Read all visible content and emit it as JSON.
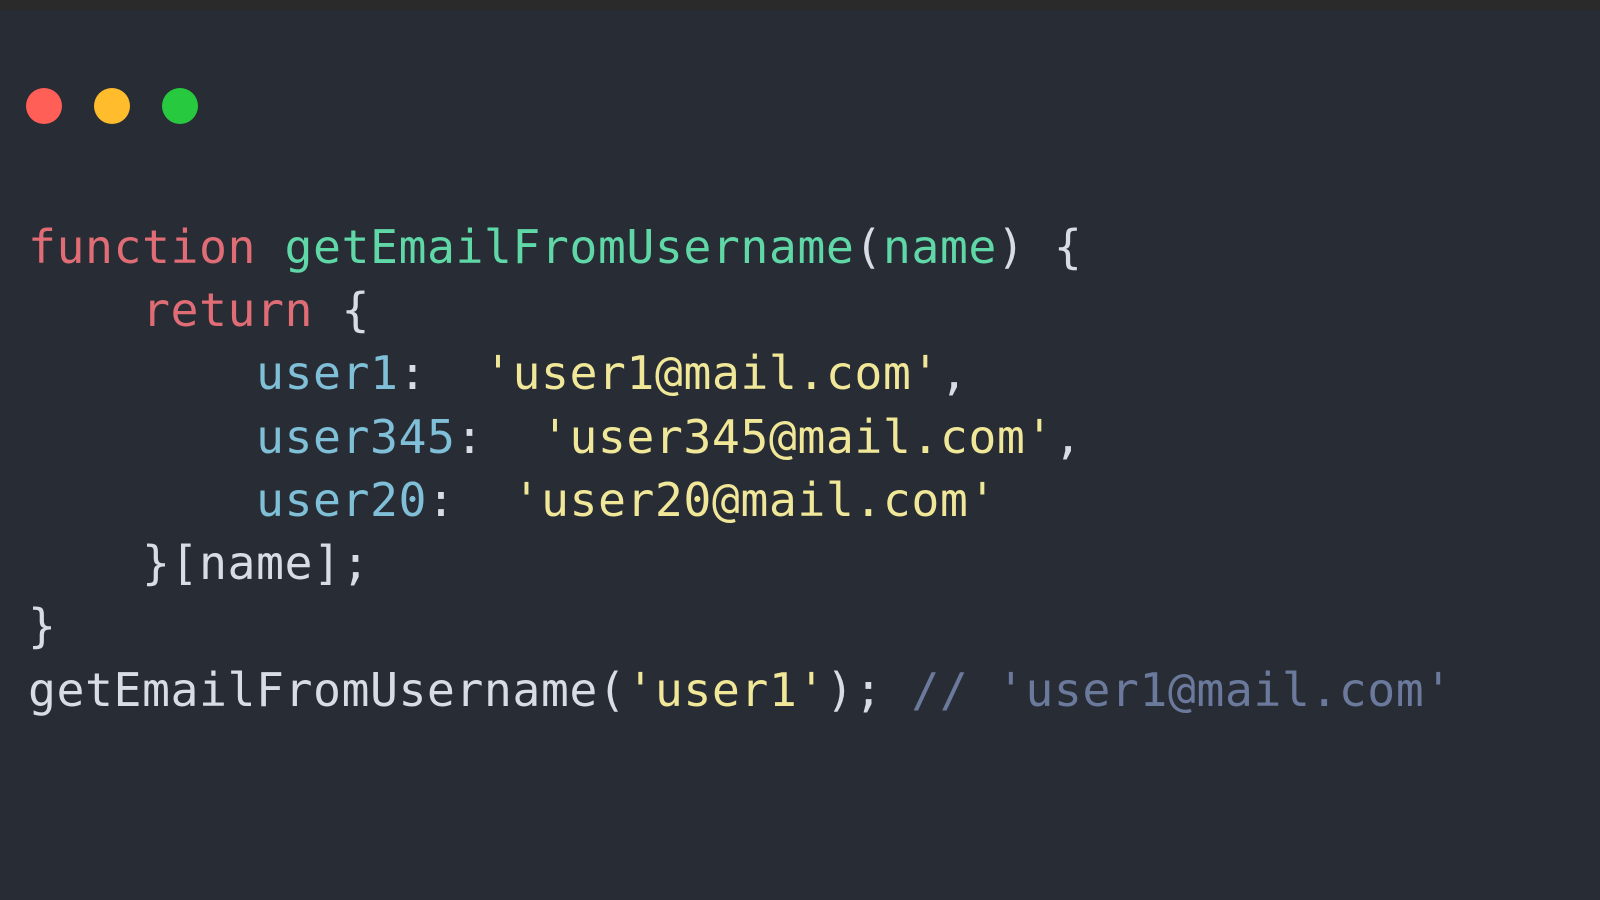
{
  "colors": {
    "background": "#282c34",
    "topbar": "#2a2a2a",
    "red": "#ff5f56",
    "yellow": "#ffbd2e",
    "green": "#27c93f",
    "keyword": "#e06c75",
    "function": "#5fd7a7",
    "property": "#7fbfd7",
    "string": "#f0e799",
    "default": "#d8dce4",
    "comment": "#6b7a9c"
  },
  "code": {
    "line1": {
      "keyword": "function",
      "space1": " ",
      "funcName": "getEmailFromUsername",
      "openParen": "(",
      "param": "name",
      "closeParen": ")",
      "space2": " ",
      "brace": "{"
    },
    "line2": {
      "indent": "    ",
      "keyword": "return",
      "space": " ",
      "brace": "{"
    },
    "line3": {
      "indent": "        ",
      "prop": "user1",
      "colon": ":",
      "space": "  ",
      "string": "'user1@mail.com'",
      "comma": ","
    },
    "line4": {
      "indent": "        ",
      "prop": "user345",
      "colon": ":",
      "space": "  ",
      "string": "'user345@mail.com'",
      "comma": ","
    },
    "line5": {
      "indent": "        ",
      "prop": "user20",
      "colon": ":",
      "space": "  ",
      "string": "'user20@mail.com'"
    },
    "line6": {
      "indent": "    ",
      "text": "}[name];"
    },
    "line7": {
      "text": "}"
    },
    "line8": {
      "text": ""
    },
    "line9": {
      "call": "getEmailFromUsername(",
      "arg": "'user1'",
      "close": ");",
      "space": " ",
      "comment": "// 'user1@mail.com'"
    }
  }
}
